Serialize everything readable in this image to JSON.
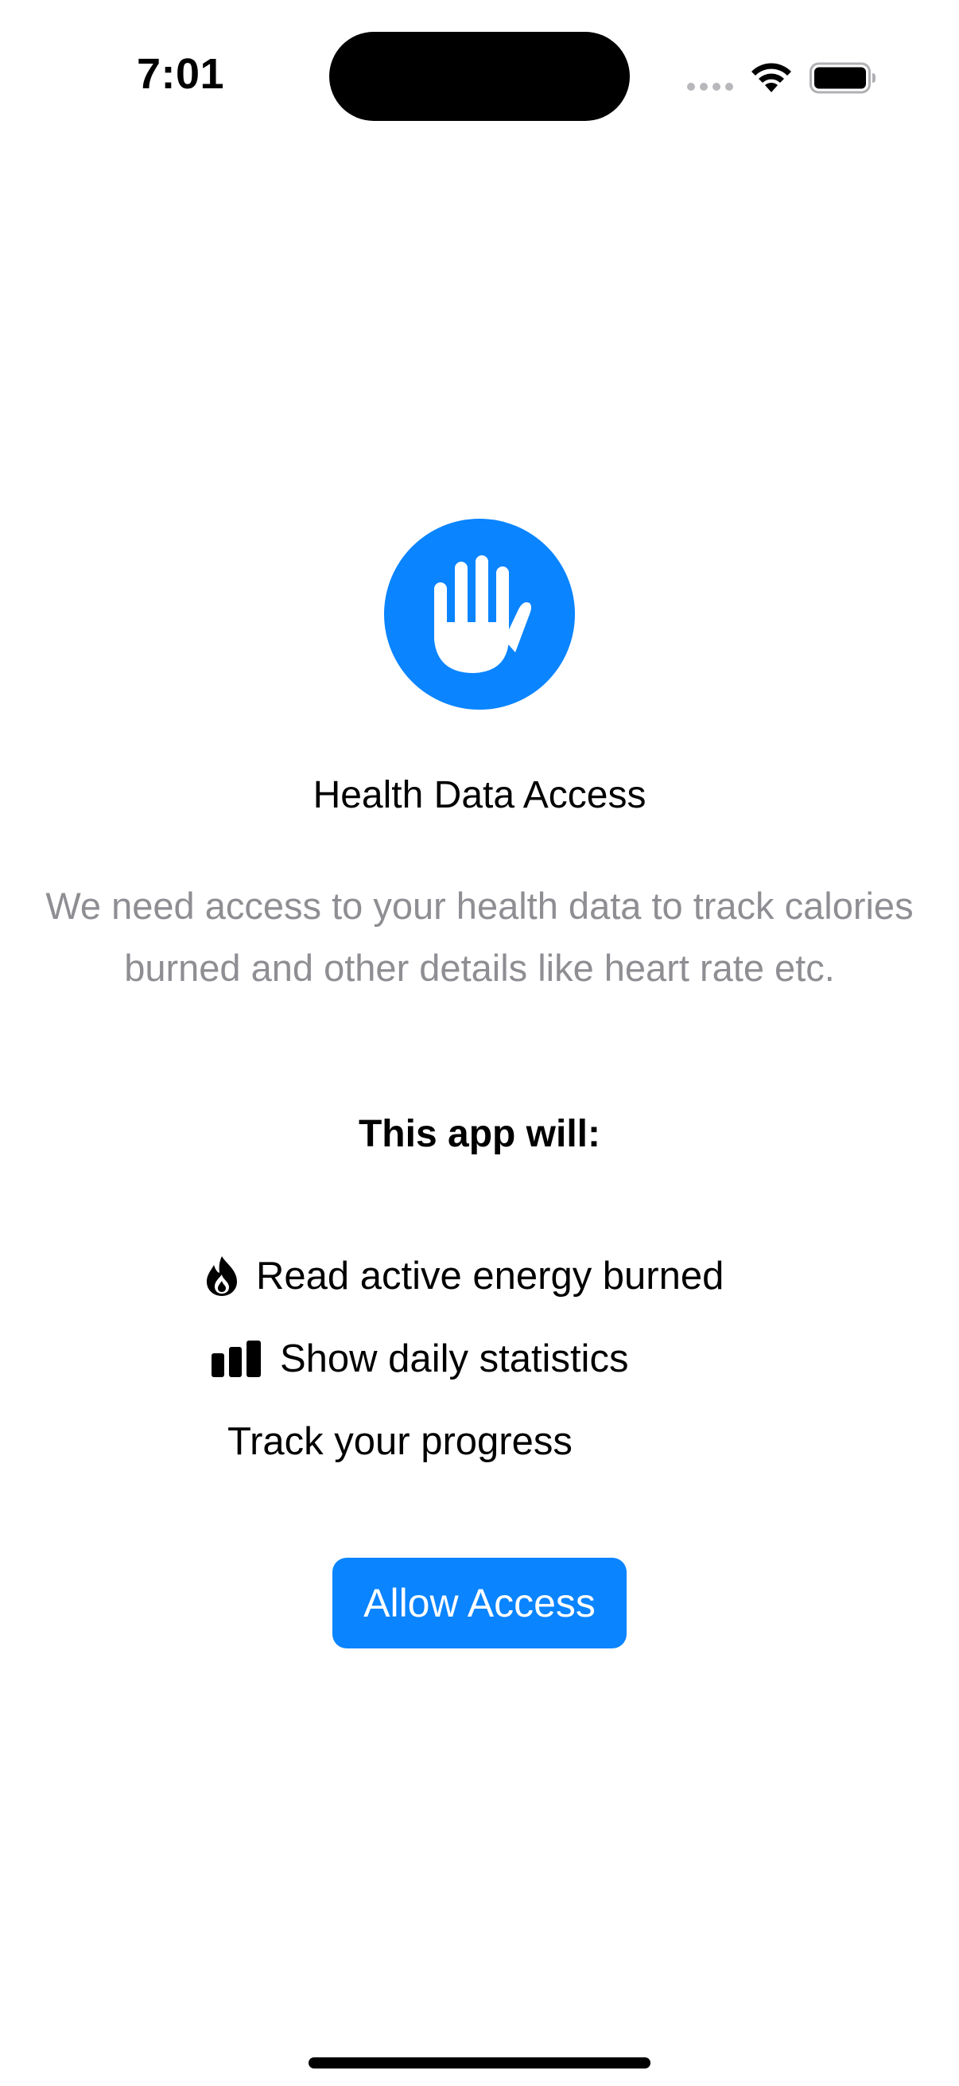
{
  "status_bar": {
    "time": "7:01"
  },
  "screen": {
    "hero_icon": "hand-raised-icon",
    "title": "Health Data Access",
    "description": "We need access to your health data to track calories burned and other details like heart rate etc.",
    "section_heading": "This app will:",
    "features": [
      {
        "icon": "flame-icon",
        "label": "Read active energy burned"
      },
      {
        "icon": "bar-chart-icon",
        "label": "Show daily statistics"
      },
      {
        "icon": "",
        "label": "Track your progress"
      }
    ],
    "allow_button_label": "Allow Access"
  },
  "colors": {
    "accent": "#0a84ff",
    "secondary_text": "#8e8e93"
  }
}
